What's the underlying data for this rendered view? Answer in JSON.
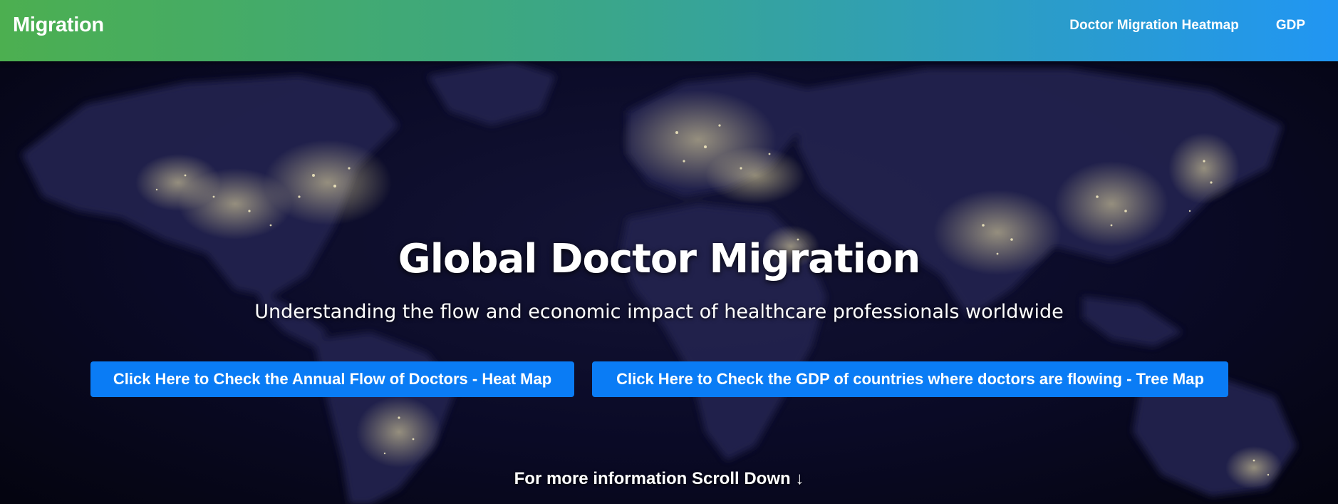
{
  "navbar": {
    "brand": "Migration",
    "links": [
      {
        "label": "Doctor Migration Heatmap"
      },
      {
        "label": "GDP"
      }
    ],
    "gradient_start": "#4caf50",
    "gradient_end": "#2196f3"
  },
  "hero": {
    "title": "Global Doctor Migration",
    "subtitle": "Understanding the flow and economic impact of healthcare professionals worldwide",
    "background": "night-earth-map",
    "buttons": [
      {
        "label": "Click Here to Check the Annual Flow of Doctors - Heat Map"
      },
      {
        "label": "Click Here to Check the GDP of countries where doctors are flowing - Tree Map"
      }
    ],
    "button_color": "#0a7cf5",
    "scroll_hint": "For more information Scroll Down",
    "scroll_icon": "arrow-down-icon"
  }
}
